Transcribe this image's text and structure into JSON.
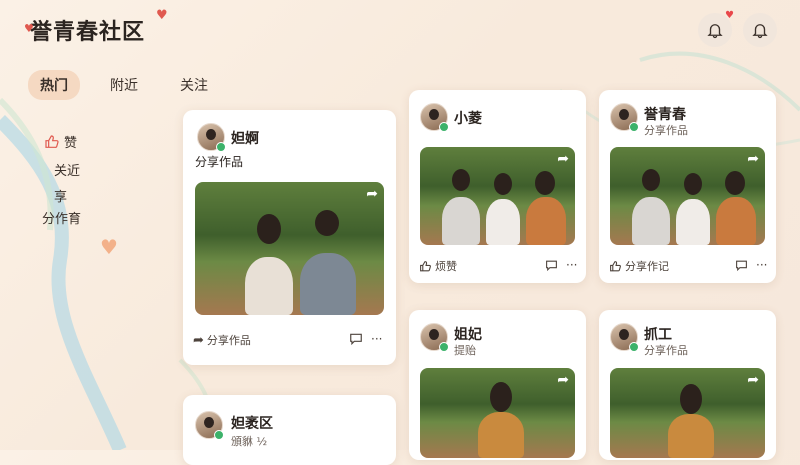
{
  "app": {
    "title": "誉青春社区"
  },
  "tabs": [
    {
      "label": "热门",
      "active": true
    },
    {
      "label": "附近",
      "active": false
    },
    {
      "label": "关注",
      "active": false
    }
  ],
  "sidebar": {
    "like_label": "赞",
    "items": [
      "关近",
      "享",
      "分作育"
    ]
  },
  "cards": [
    {
      "name": "妲婀",
      "subtitle": "分享作品",
      "action": "分享作品"
    },
    {
      "name": "小菱",
      "subtitle": "",
      "action": "烦赞"
    },
    {
      "name": "誉青春",
      "subtitle": "分享作品",
      "action": "分享作记"
    },
    {
      "name": "姐妃",
      "subtitle": "提贻",
      "action": ""
    },
    {
      "name": "抓工",
      "subtitle": "分享作品",
      "action": ""
    },
    {
      "name": "妲袤区",
      "subtitle": "頒貅 ½",
      "action": ""
    }
  ],
  "colors": {
    "accent": "#f5d9c2",
    "online": "#3cb26a",
    "heart": "#e0594f"
  },
  "icons": [
    "heart-icon",
    "bell-icon",
    "like-icon",
    "share-icon",
    "comment-icon",
    "more-icon"
  ]
}
